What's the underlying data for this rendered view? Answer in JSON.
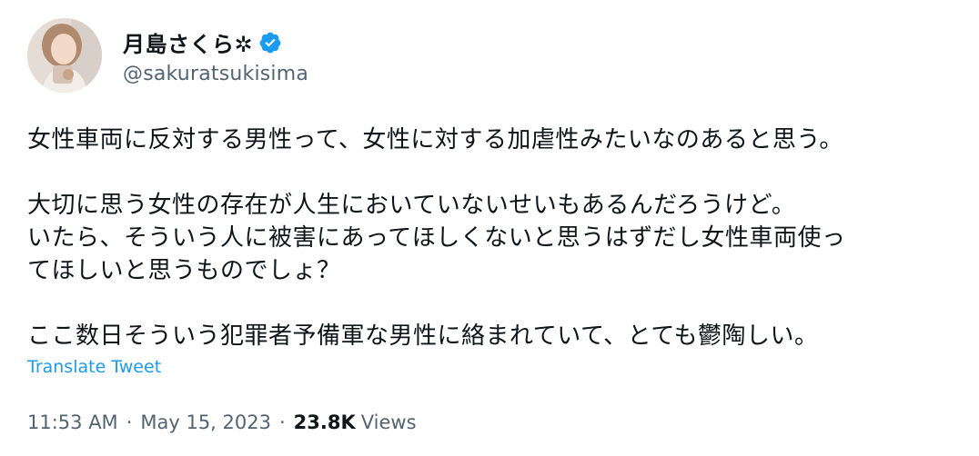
{
  "author": {
    "display_name": "月島さくら✲",
    "handle": "@sakuratsukisima",
    "verified_color": "#1d9bf0"
  },
  "tweet": {
    "lines": [
      "女性車両に反対する男性って、女性に対する加虐性みたいなのあると思う。",
      "",
      "大切に思う女性の存在が人生においていないせいもあるんだろうけど。",
      "いたら、そういう人に被害にあってほしくないと思うはずだし女性車両使っ",
      "てほしいと思うものでしょ？",
      "",
      "ここ数日そういう犯罪者予備軍な男性に絡まれていて、とても鬱陶しい。"
    ],
    "translate_label": "Translate Tweet",
    "time": "11:53 AM",
    "separator": "·",
    "date": "May 15, 2023",
    "views_count": "23.8K",
    "views_label": "Views"
  }
}
